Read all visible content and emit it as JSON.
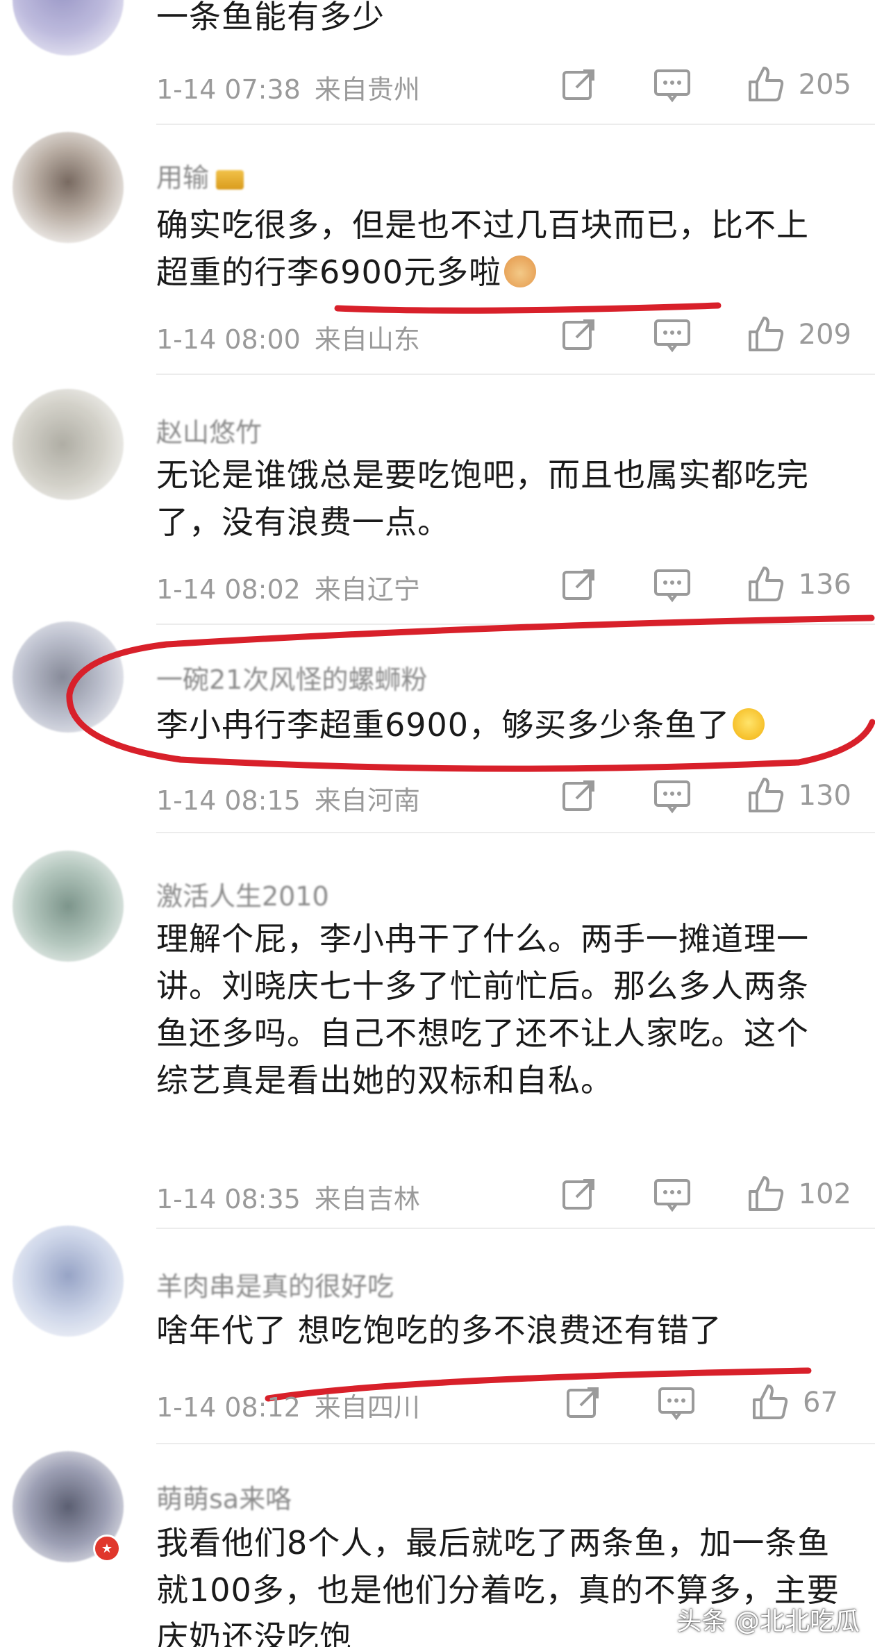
{
  "comments": [
    {
      "username": "",
      "text": "一条鱼能有多少",
      "time": "1-14 07:38",
      "location": "来自贵州",
      "likes": "205"
    },
    {
      "username": "用输",
      "text": "确实吃很多，但是也不过几百块而已，比不上超重的行李6900元多啦",
      "time": "1-14 08:00",
      "location": "来自山东",
      "likes": "209"
    },
    {
      "username": "赵山悠竹",
      "text": "无论是谁饿总是要吃饱吧，而且也属实都吃完了，没有浪费一点。",
      "time": "1-14 08:02",
      "location": "来自辽宁",
      "likes": "136"
    },
    {
      "username": "一碗21次风怪的螺蛳粉",
      "text": "李小冉行李超重6900，够买多少条鱼了",
      "time": "1-14 08:15",
      "location": "来自河南",
      "likes": "130"
    },
    {
      "username": "激活人生2010",
      "text": "理解个屁，李小冉干了什么。两手一摊道理一讲。刘晓庆七十多了忙前忙后。那么多人两条鱼还多吗。自己不想吃了还不让人家吃。这个综艺真是看出她的双标和自私。",
      "time": "1-14 08:35",
      "location": "来自吉林",
      "likes": "102"
    },
    {
      "username": "羊肉串是真的很好吃",
      "text": "啥年代了 想吃饱吃的多不浪费还有错了",
      "time": "1-14 08:12",
      "location": "来自四川",
      "likes": "67"
    },
    {
      "username": "萌萌sa来咯",
      "text": "我看他们8个人，最后就吃了两条鱼，加一条鱼就100多，也是他们分着吃，真的不算多，主要庆奶还没吃饱",
      "time": "",
      "location": "",
      "likes": ""
    }
  ],
  "icons": {
    "share": "share-icon",
    "reply": "comment-icon",
    "like": "thumbs-up-icon"
  },
  "colors": {
    "annotation_red": "#d8202a",
    "meta_gray": "#9a9a9a"
  },
  "watermark": "头条 @北北吃瓜"
}
